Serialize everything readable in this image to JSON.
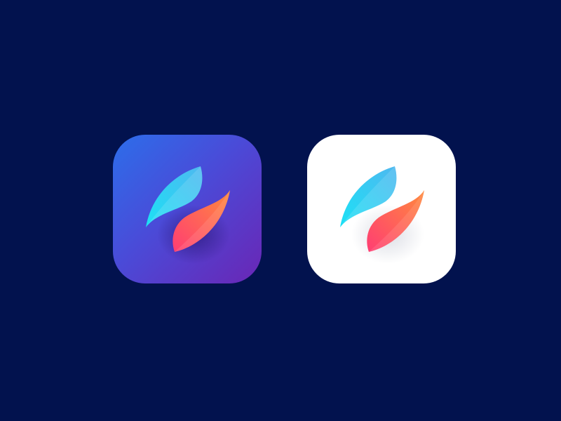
{
  "background_color": "#02124E",
  "icons": [
    {
      "name": "app-icon-dark-variant",
      "tile_gradient": [
        "#2C6EEA",
        "#4A4BD8",
        "#6A26B5"
      ],
      "mark": {
        "upper_leaf_gradient": [
          "#1BE1F5",
          "#4FB8F0"
        ],
        "lower_leaf_gradient": [
          "#FF8A3D",
          "#FF3D73"
        ]
      }
    },
    {
      "name": "app-icon-light-variant",
      "tile_color": "#FFFFFF",
      "mark": {
        "upper_leaf_gradient": [
          "#1BE1F5",
          "#4FB8F0"
        ],
        "lower_leaf_gradient": [
          "#FF8A3D",
          "#FF3D73"
        ]
      }
    }
  ]
}
